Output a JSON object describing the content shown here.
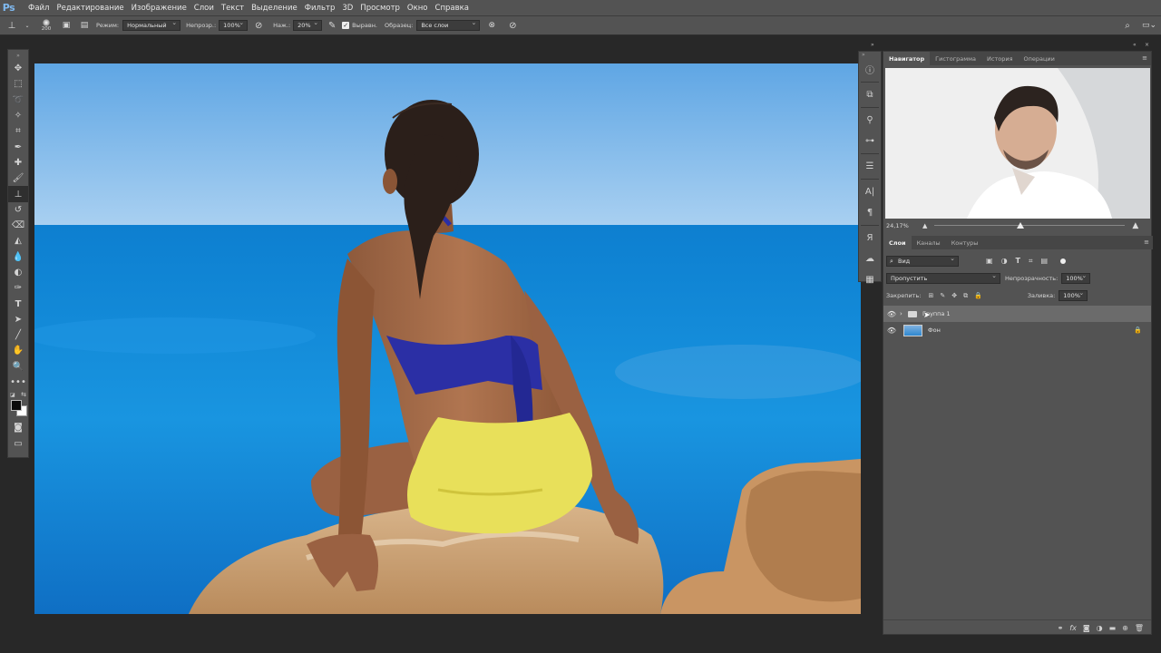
{
  "app": {
    "logo": "Ps"
  },
  "menu": [
    "Файл",
    "Редактирование",
    "Изображение",
    "Слои",
    "Текст",
    "Выделение",
    "Фильтр",
    "3D",
    "Просмотр",
    "Окно",
    "Справка"
  ],
  "options": {
    "brush_size": "200",
    "mode_label": "Режим:",
    "mode_value": "Нормальный",
    "opacity_label": "Непрозр.:",
    "opacity_value": "100%",
    "pressure_label": "Наж.:",
    "pressure_value": "20%",
    "aligned_label": "Выравн.",
    "sample_label": "Образец:",
    "sample_value": "Все слои"
  },
  "tools": [
    "move-tool",
    "marquee-tool",
    "lasso-tool",
    "magic-wand-tool",
    "crop-tool",
    "eyedropper-tool",
    "healing-brush-tool",
    "brush-tool",
    "clone-stamp-tool",
    "history-brush-tool",
    "eraser-tool",
    "paint-bucket-tool",
    "blur-tool",
    "dodge-tool",
    "pen-tool",
    "type-tool",
    "path-selection-tool",
    "line-tool",
    "hand-tool",
    "zoom-tool",
    "more-tools"
  ],
  "navigator": {
    "tabs": [
      "Навигатор",
      "Гистограмма",
      "История",
      "Операции"
    ],
    "zoom": "24,17%",
    "zoom_fraction": 0.45
  },
  "layers_panel": {
    "tabs": [
      "Слои",
      "Каналы",
      "Контуры"
    ],
    "filter_value": "Вид",
    "blend_mode": "Пропустить",
    "opacity_label": "Непрозрачность:",
    "opacity_value": "100%",
    "lock_label": "Закрепить:",
    "fill_label": "Заливка:",
    "fill_value": "100%",
    "layers": [
      {
        "name": "Группа 1",
        "type": "group",
        "selected": true
      },
      {
        "name": "Фон",
        "type": "image",
        "locked": true
      }
    ]
  },
  "colors": {
    "ui_bg": "#535353",
    "workspace": "#282828",
    "accent": "#7fb9f0"
  }
}
